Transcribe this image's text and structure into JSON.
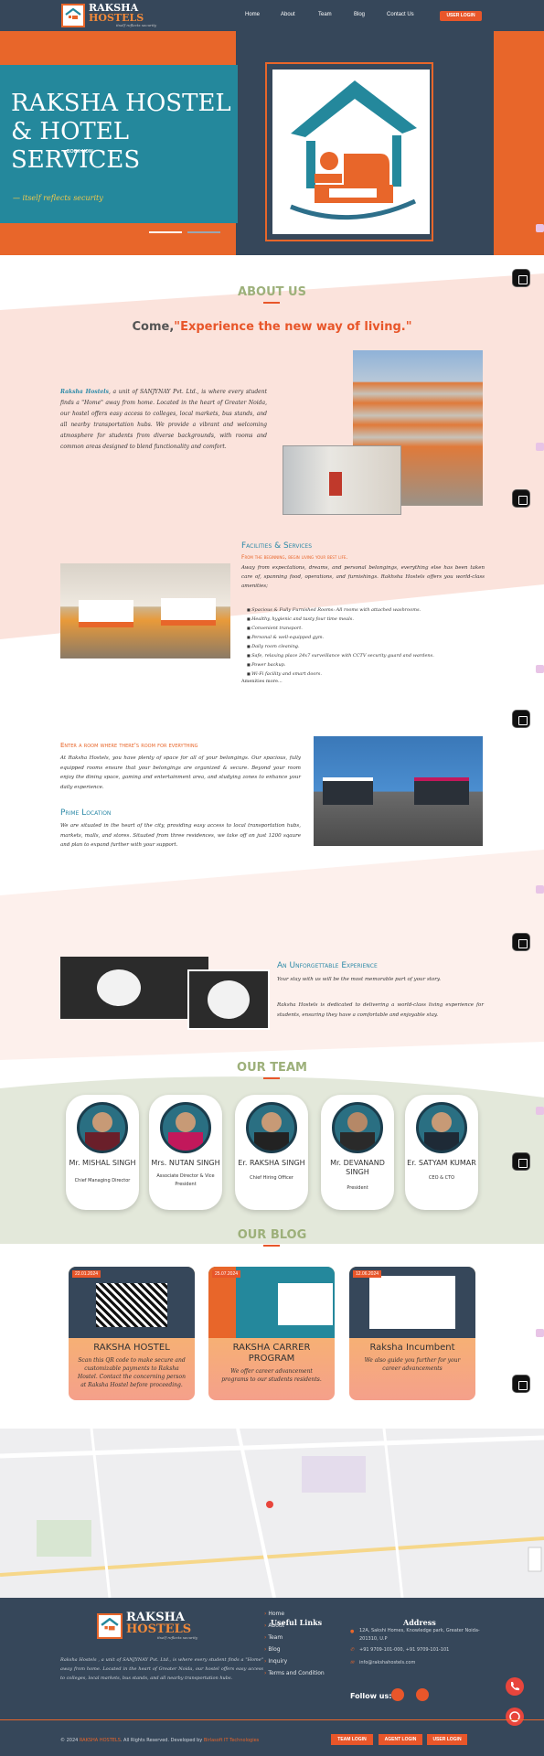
{
  "brand": {
    "name_line1": "RAKSHA",
    "name_line2": "HOSTELS",
    "tagline": "itself reflects security"
  },
  "nav": {
    "items": [
      "Home",
      "About",
      "Team",
      "Blog",
      "Contact Us"
    ],
    "login": "USER LOGIN"
  },
  "hero": {
    "title": "RAKSHA HOSTEL & HOTEL SERVICES",
    "book_now": "BOOK NOW",
    "tagline": "— itself reflects security"
  },
  "about": {
    "heading": "ABOUT US",
    "subheading_prefix": "Come,",
    "subheading_quote": "\"Experience the new way of living.\"",
    "para_lead": "Raksha Hostels",
    "para": ", a unit of SANJYNAY Pvt. Ltd., is where every student finds a \"Home\" away from home. Located in the heart of Greater Noida, our hostel offers easy access to colleges, local markets, bus stands, and all nearby transportation hubs. We provide a vibrant and welcoming atmosphere for students from diverse backgrounds, with rooms and common areas designed to blend functionality and comfort."
  },
  "facilities": {
    "title": "Facilities & Services",
    "subtitle": "From the beginning, begin living your best life.",
    "para": "Away from expectations, dreams, and personal belongings, everything else has been taken care of, spanning food, operations, and furnishings. Rakhsha Hostels offers you world-class amenities;",
    "items": [
      "Spacious & Fully Furnished Rooms: All rooms with attached washrooms.",
      "Healthy, hygienic and tasty four time meals.",
      "Convenient transport.",
      "Personal & well-equipped gym.",
      "Daily room cleaning.",
      "Safe, relaxing place 24x7 surveillance with CCTV security guard and wardens.",
      "Power backup.",
      "Wi-Fi facility and smart doors."
    ],
    "more": "Amenities more..."
  },
  "room": {
    "title": "Enter a room where there's room for everything",
    "para": "At Raksha Hostels, you have plenty of space for all of your belongings. Our spacious, fully equipped rooms ensure that your belongings are organized & secure. Beyond your room enjoy the dining space, gaming and entertainment area, and studying zones to enhance your daily experience.",
    "loc_title": "Prime Location",
    "loc_para": "We are situated in the heart of the city, providing easy access to local transportation hubs, markets, malls, and stores. Situated from three residences, we take off on just 1200 sqaure and plan to expand further with your support."
  },
  "experience": {
    "title": "An Unforgettable Experience",
    "para1": "Your stay with us will be the most memorable part of your story.",
    "para2": "Raksha Hostels is dedicated to delivering a world-class living experience for students, ensuring they have a comfortable and enjoyable stay."
  },
  "team": {
    "heading": "OUR TEAM",
    "members": [
      {
        "name": "Mr. MISHAL SINGH",
        "role": "Chief Managing Director"
      },
      {
        "name": "Mrs. NUTAN SINGH",
        "role": "Associate Director & Vice President"
      },
      {
        "name": "Er. RAKSHA SINGH",
        "role": "Chief Hiring Officer"
      },
      {
        "name": "Mr. DEVANAND SINGH",
        "role": "President"
      },
      {
        "name": "Er. SATYAM KUMAR",
        "role": "CEO & CTO"
      }
    ]
  },
  "blog": {
    "heading": "OUR BLOG",
    "posts": [
      {
        "date": "22.01.2024",
        "title": "RAKSHA HOSTEL",
        "desc": "Scan this QR code to make secure and customizable payments to Raksha Hostel. Contact the concerning person at Raksha Hostel before proceeding."
      },
      {
        "date": "25.07.2024",
        "title": "RAKSHA CARRER PROGRAM",
        "desc": "We offer career advancement programs to our students residents."
      },
      {
        "date": "12.06.2024",
        "title": "Raksha Incumbent",
        "desc": "We also guide you further for your career advancements"
      }
    ]
  },
  "footer": {
    "about": "Raksha Hostels , a unit of SANJYNAY Pvt. Ltd., is where every student finds a \"Home\" away from home. Located in the heart of Greater Noida, our hostel offers easy access to colleges, local markets, bus stands, and all nearby transportation hubs.",
    "links_heading": "Useful Links",
    "links": [
      "Home",
      "About",
      "Team",
      "Blog",
      "Inquiry",
      "Terms and Condition"
    ],
    "address_heading": "Address",
    "address": "12A, Sakshi Homes, Knowledge park, Greater Noida-201310, U.P",
    "phone": "+91 9709-101-000, +91 9709-101-101",
    "email": "info@rakshahostels.com",
    "follow": "Follow us:",
    "copyright_prefix": "© 2024 ",
    "copyright_brand": "RAKSHA HOSTELS",
    "copyright_mid": ". All Rights Reserved. Developed by ",
    "copyright_dev": "Birlasoft IT Technologies",
    "buttons": [
      "TEAM LOGIN",
      "AGENT LOGIN",
      "USER LOGIN"
    ]
  },
  "colors": {
    "navy": "#36475a",
    "orange": "#e8662a",
    "teal": "#24889c",
    "green": "#9db07a"
  }
}
